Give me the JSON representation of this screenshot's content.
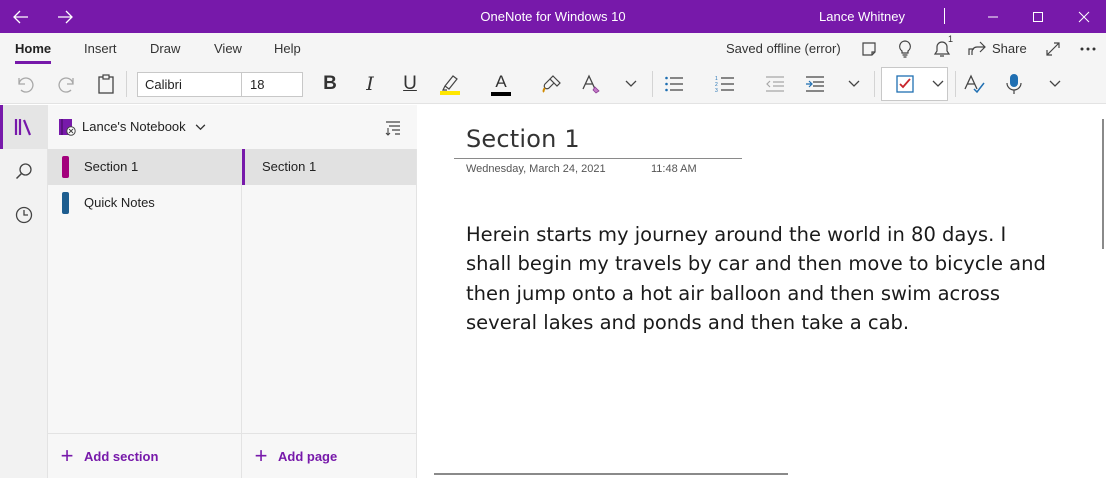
{
  "titlebar": {
    "title": "OneNote for Windows 10",
    "user": "Lance Whitney",
    "back_icon": "arrow-left-icon",
    "forward_icon": "arrow-right-icon"
  },
  "menu": {
    "tabs": [
      {
        "label": "Home",
        "active": true
      },
      {
        "label": "Insert"
      },
      {
        "label": "Draw"
      },
      {
        "label": "View"
      },
      {
        "label": "Help"
      }
    ],
    "status": "Saved offline (error)",
    "notification_count": "1",
    "share_label": "Share"
  },
  "ribbon": {
    "font_name": "Calibri",
    "font_size": "18",
    "bold": "B",
    "italic": "I",
    "underline": "U",
    "font_color_letter": "A",
    "highlight_color": "#ffe600",
    "font_color": "#000000",
    "todo_check_color": "#c8262c"
  },
  "notebook": {
    "name": "Lance's Notebook",
    "sections": [
      {
        "label": "Section 1",
        "color": "#a3007c",
        "active": true
      },
      {
        "label": "Quick Notes",
        "color": "#1d5d8f"
      }
    ],
    "pages": [
      {
        "label": "Section 1",
        "active": true
      }
    ],
    "add_section": "Add section",
    "add_page": "Add page"
  },
  "page": {
    "title": "Section 1",
    "date": "Wednesday, March 24, 2021",
    "time": "11:48 AM",
    "body": "Herein starts my journey around the world in 80 days. I shall begin my travels by car and then move to bicycle and then jump onto a hot air balloon and then swim across several lakes and ponds and then take a cab."
  },
  "colors": {
    "accent": "#7719aa"
  }
}
